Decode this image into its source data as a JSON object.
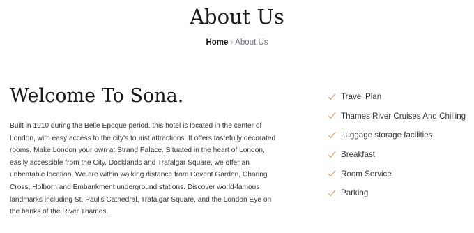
{
  "header": {
    "title": "About Us",
    "breadcrumb": {
      "home": "Home",
      "separator": "›",
      "current": "About Us"
    }
  },
  "about": {
    "heading": "Welcome To Sona.",
    "paragraph": "Built in 1910 during the Belle Epoque period, this hotel is located in the center of London, with easy access to the city's tourist attractions. It offers tastefully decorated rooms. Make London your own at Strand Palace. Situated in the heart of London, easily accessible from the City, Docklands and Trafalgar Square, we offer an unbeatable location. We are within walking distance from Covent Garden, Charing Cross, Holborn and Embankment underground stations. Discover world-famous landmarks including St. Paul's Cathedral, Trafalgar Square, and the London Eye on the banks of the River Thames."
  },
  "features": {
    "icon": "check-icon",
    "items": [
      "Travel Plan",
      "Thames River Cruises And Chilling",
      "Luggage storage facilities",
      "Breakfast",
      "Room Service",
      "Parking"
    ]
  },
  "colors": {
    "accent": "#dfa974",
    "text_dark": "#19191a",
    "text_body": "#35353a",
    "text_muted": "#707079"
  }
}
